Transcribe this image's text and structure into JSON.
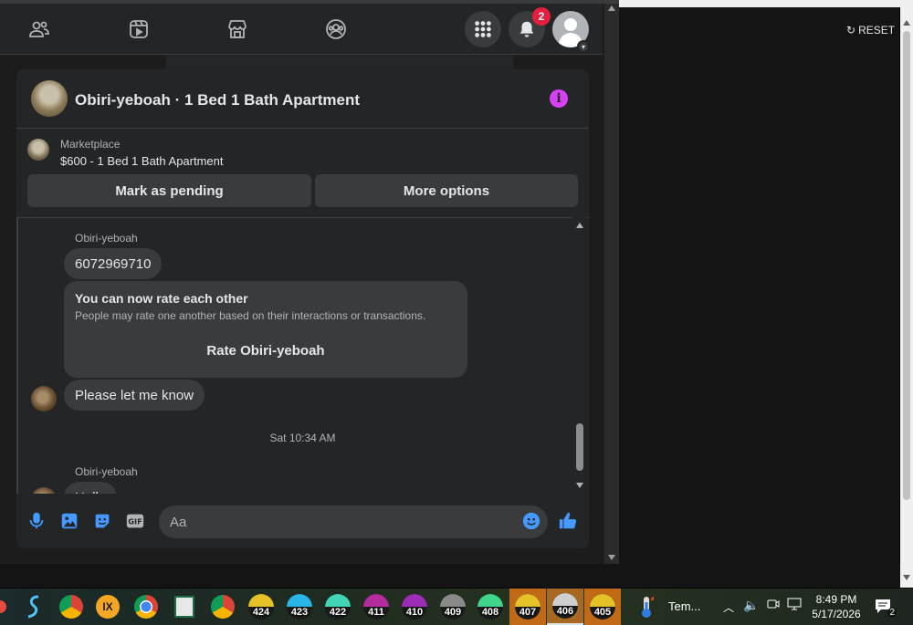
{
  "nav": {
    "notifications_count": "2"
  },
  "chat": {
    "title": "Obiri-yeboah · 1 Bed 1 Bath Apartment",
    "marketplace": {
      "label": "Marketplace",
      "item": "$600 - 1 Bed 1 Bath Apartment",
      "mark_pending": "Mark as pending",
      "more_options": "More options"
    },
    "messages": {
      "sender1": "Obiri-yeboah",
      "phone": "6072969710",
      "rate_title": "You can now rate each other",
      "rate_sub": "People may rate one another based on their interactions or transactions.",
      "rate_btn": "Rate Obiri-yeboah",
      "please": "Please let me know",
      "timestamp": "Sat 10:34 AM",
      "sender2": "Obiri-yeboah",
      "hello": "Hello"
    },
    "composer": {
      "placeholder": "Aa"
    }
  },
  "right": {
    "reset": "RESET"
  },
  "taskbar": {
    "gauges": [
      "424",
      "423",
      "422",
      "411",
      "410",
      "409",
      "408",
      "407",
      "406",
      "405"
    ],
    "temp_label": "Tem...",
    "time": "8:49 PM",
    "date": "5/17/2026",
    "notif_count": "2"
  },
  "colors": {
    "accent_info": "#d741f5",
    "badge": "#e41e3f",
    "like": "#4599ff",
    "taskbar_active": "#c06a18"
  }
}
